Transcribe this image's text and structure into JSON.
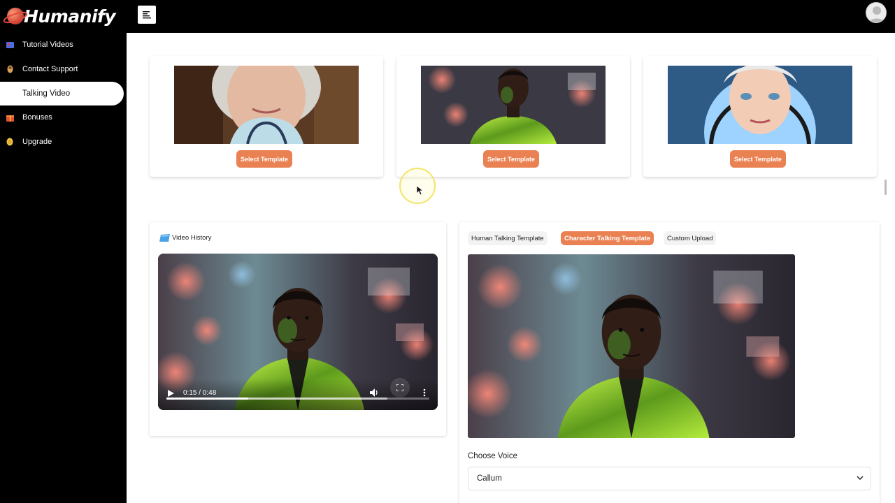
{
  "app": {
    "logo_text": "Humanify"
  },
  "sidebar": {
    "items": [
      {
        "label": "Tutorial Videos",
        "icon": "film-icon"
      },
      {
        "label": "Contact Support",
        "icon": "support-icon"
      },
      {
        "label": "Talking Video",
        "icon": "video-icon",
        "active": true
      },
      {
        "label": "Bonuses",
        "icon": "gift-icon"
      },
      {
        "label": "Upgrade",
        "icon": "coin-icon"
      }
    ]
  },
  "templates": [
    {
      "button_label": "Select Template",
      "subject": "elderly woman doctor"
    },
    {
      "button_label": "Select Template",
      "subject": "man in neon green jacket"
    },
    {
      "button_label": "Select Template",
      "subject": "animated character white hair"
    }
  ],
  "video_history": {
    "title": "Video History",
    "player": {
      "time": "0:15 / 0:48",
      "played_fraction": 0.31,
      "buffered_fraction": 0.84
    }
  },
  "talking_panel": {
    "tabs": [
      {
        "label": "Human Talking Template",
        "active": false
      },
      {
        "label": "Character Talking Template",
        "active": true
      },
      {
        "label": "Custom Upload",
        "active": false
      }
    ],
    "voice_label": "Choose Voice",
    "voice_selected": "Callum"
  },
  "colors": {
    "accent": "#ea8152",
    "sidebar_bg": "#000000",
    "topbar_bg": "#000000"
  }
}
